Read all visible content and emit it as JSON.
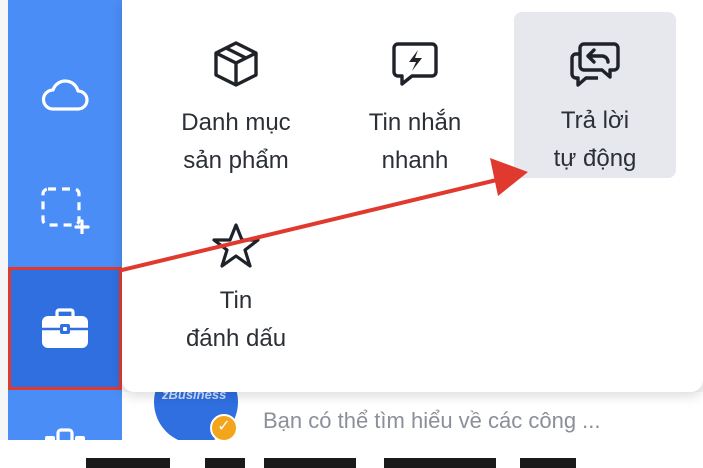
{
  "sidebar": {
    "items": [
      {
        "name": "cloud",
        "icon": "cloud-icon"
      },
      {
        "name": "select-area",
        "icon": "select-area-icon"
      },
      {
        "name": "business-tools",
        "icon": "briefcase-icon",
        "active": true
      },
      {
        "name": "more",
        "icon": "apps-icon"
      }
    ],
    "color": "#4b8df6",
    "active_color": "#2f6fe0"
  },
  "tools_panel": {
    "tools": [
      {
        "label_line1": "Danh mục",
        "label_line2": "sản phẩm",
        "icon": "box-icon"
      },
      {
        "label_line1": "Tin nhắn",
        "label_line2": "nhanh",
        "icon": "quick-message-icon"
      },
      {
        "label_line1": "Trả lời",
        "label_line2": "tự động",
        "icon": "auto-reply-icon",
        "highlighted": true
      },
      {
        "label_line1": "Tin",
        "label_line2": "đánh dấu",
        "icon": "star-icon"
      }
    ]
  },
  "chat_preview": {
    "avatar_label": "zBusiness",
    "badge_icon": "verified-check-icon",
    "message": "Bạn có thể tìm hiểu về các công ..."
  },
  "annotation": {
    "highlight_color": "#e03a2e",
    "arrow_color": "#e03a2e"
  }
}
